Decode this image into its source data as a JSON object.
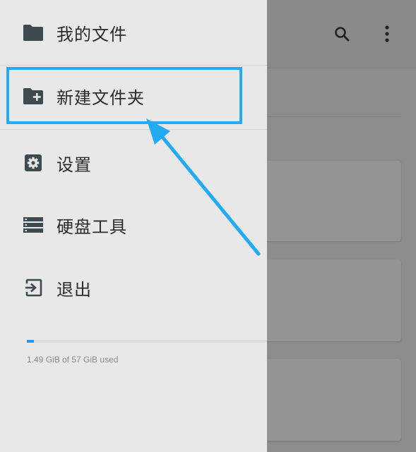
{
  "drawer": {
    "items": [
      {
        "label": "我的文件",
        "icon": "folder-icon"
      },
      {
        "label": "新建文件夹",
        "icon": "folder-add-icon"
      },
      {
        "label": "设置",
        "icon": "gear-icon"
      },
      {
        "label": "硬盘工具",
        "icon": "storage-icon"
      },
      {
        "label": "退出",
        "icon": "exit-icon"
      }
    ],
    "storage": {
      "text": "1.49 GiB of 57 GiB used",
      "used_fraction": 0.026
    }
  },
  "toolbar": {
    "search_icon": "search-icon",
    "menu_icon": "more-vert-icon"
  },
  "colors": {
    "highlight": "#22aaf2",
    "accent": "#2196f3",
    "drawer_bg": "#e8e8e8",
    "icon": "#3d4a50"
  }
}
